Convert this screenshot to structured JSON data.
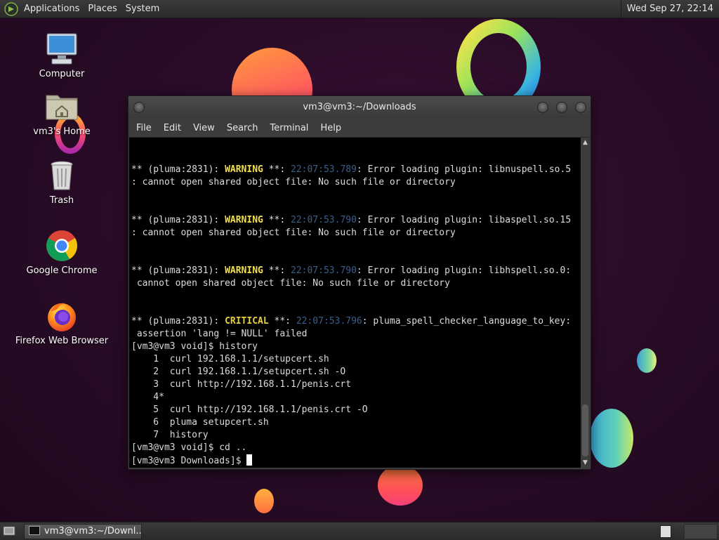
{
  "top_panel": {
    "menus": [
      "Applications",
      "Places",
      "System"
    ],
    "clock": "Wed Sep 27, 22:14",
    "logo_icon": "mate-logo-icon"
  },
  "desktop": {
    "icons": [
      {
        "label": "Computer",
        "icon": "computer-icon"
      },
      {
        "label": "vm3's Home",
        "icon": "home-folder-icon"
      },
      {
        "label": "Trash",
        "icon": "trash-icon"
      },
      {
        "label": "Google Chrome",
        "icon": "chrome-icon"
      },
      {
        "label": "Firefox Web Browser",
        "icon": "firefox-icon"
      }
    ]
  },
  "terminal": {
    "title": "vm3@vm3:~/Downloads",
    "menu": [
      "File",
      "Edit",
      "View",
      "Search",
      "Terminal",
      "Help"
    ],
    "log": [
      {
        "prefix": "** (pluma:2831): ",
        "level": "WARNING",
        "mid": " **: ",
        "time": "22:07:53.789",
        "msg": ": Error loading plugin: libnuspell.so.5",
        "cont": ": cannot open shared object file: No such file or directory"
      },
      {
        "prefix": "** (pluma:2831): ",
        "level": "WARNING",
        "mid": " **: ",
        "time": "22:07:53.790",
        "msg": ": Error loading plugin: libaspell.so.15",
        "cont": ": cannot open shared object file: No such file or directory"
      },
      {
        "prefix": "** (pluma:2831): ",
        "level": "WARNING",
        "mid": " **: ",
        "time": "22:07:53.790",
        "msg": ": Error loading plugin: libhspell.so.0:",
        "cont": " cannot open shared object file: No such file or directory"
      },
      {
        "prefix": "** (pluma:2831): ",
        "level": "CRITICAL",
        "mid": " **: ",
        "time": "22:07:53.796",
        "msg": ": pluma_spell_checker_language_to_key:",
        "cont": " assertion 'lang != NULL' failed"
      }
    ],
    "tail_lines": [
      "[vm3@vm3 void]$ history",
      "    1  curl 192.168.1.1/setupcert.sh",
      "    2  curl 192.168.1.1/setupcert.sh -O",
      "    3  curl http://192.168.1.1/penis.crt",
      "    4*",
      "    5  curl http://192.168.1.1/penis.crt -O",
      "    6  pluma setupcert.sh",
      "    7  history",
      "[vm3@vm3 void]$ cd .."
    ],
    "prompt": "[vm3@vm3 Downloads]$ "
  },
  "bottom_panel": {
    "task_label": "vm3@vm3:~/Downl..."
  }
}
